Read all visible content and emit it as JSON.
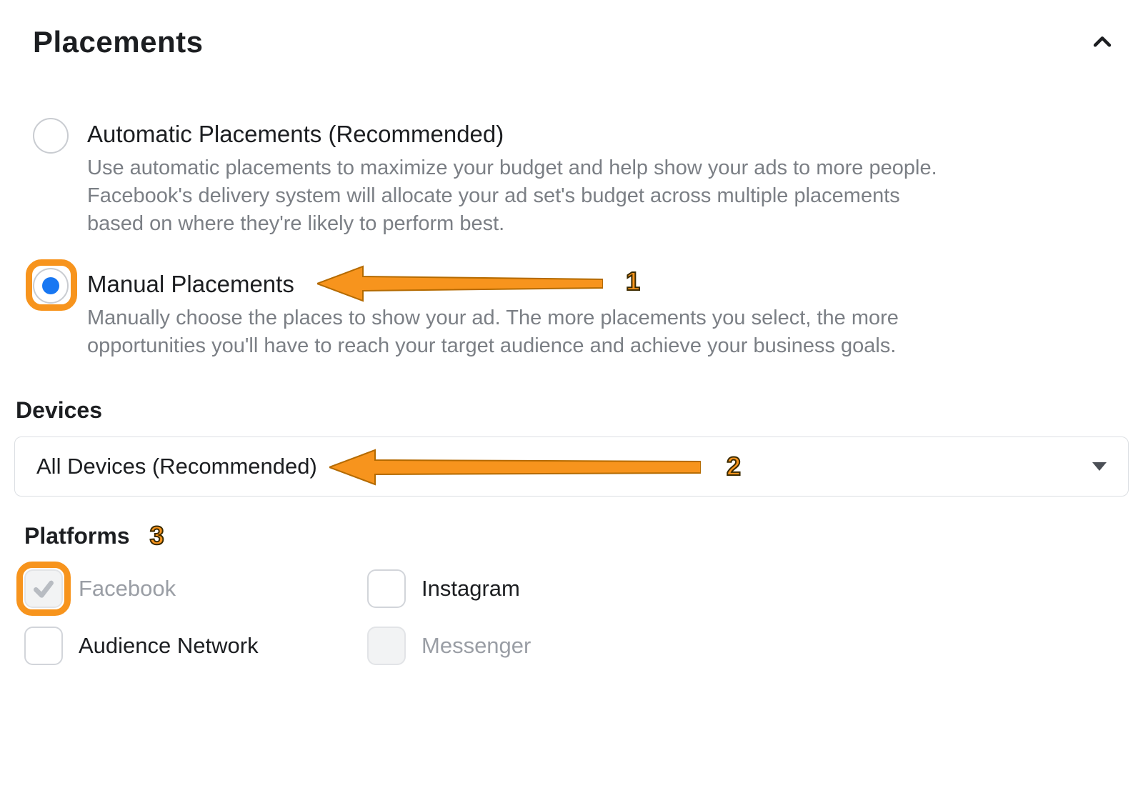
{
  "section": {
    "title": "Placements"
  },
  "options": {
    "automatic": {
      "title": "Automatic Placements (Recommended)",
      "description": "Use automatic placements to maximize your budget and help show your ads to more people. Facebook's delivery system will allocate your ad set's budget across multiple placements based on where they're likely to perform best."
    },
    "manual": {
      "title": "Manual Placements",
      "description": "Manually choose the places to show your ad. The more placements you select, the more opportunities you'll have to reach your target audience and achieve your business goals."
    }
  },
  "devices": {
    "heading": "Devices",
    "selected": "All Devices (Recommended)"
  },
  "platforms": {
    "heading": "Platforms",
    "items": [
      {
        "key": "facebook",
        "label": "Facebook"
      },
      {
        "key": "instagram",
        "label": "Instagram"
      },
      {
        "key": "audience-network",
        "label": "Audience Network"
      },
      {
        "key": "messenger",
        "label": "Messenger"
      }
    ]
  },
  "annotations": {
    "n1": "1",
    "n2": "2",
    "n3": "3",
    "color": "#f7941d"
  }
}
